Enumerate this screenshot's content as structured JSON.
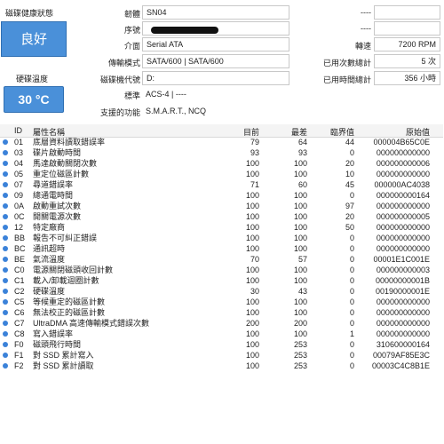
{
  "health": {
    "label": "磁碟健康狀態",
    "status": "良好"
  },
  "temperature": {
    "label": "硬碟溫度",
    "value": "30 °C"
  },
  "info": {
    "firmware_label": "韌體",
    "firmware_value": "SN04",
    "serial_label": "序號",
    "interface_label": "介面",
    "interface_value": "Serial ATA",
    "transfer_label": "傳輸模式",
    "transfer_value": "SATA/600 | SATA/600",
    "drive_letter_label": "磁碟機代號",
    "drive_letter_value": "D:",
    "standard_label": "標準",
    "standard_value": "ACS-4 | ----",
    "features_label": "支援的功能",
    "features_value": "S.M.A.R.T., NCQ",
    "right_blank1_label": "----",
    "right_blank1_value": "",
    "right_blank2_label": "----",
    "right_blank2_value": "",
    "rpm_label": "轉速",
    "rpm_value": "7200 RPM",
    "power_count_label": "已用次數總計",
    "power_count_value": "5 次",
    "power_hours_label": "已用時間總計",
    "power_hours_value": "356 小時"
  },
  "table": {
    "headers": {
      "id": "ID",
      "name": "屬性名稱",
      "current": "目前",
      "worst": "最差",
      "threshold": "臨界值",
      "raw": "原始值"
    },
    "rows": [
      {
        "id": "01",
        "name": "底層資料讀取錯誤率",
        "current": "79",
        "worst": "64",
        "threshold": "44",
        "raw": "000004B65C0E"
      },
      {
        "id": "03",
        "name": "碟片啟動時間",
        "current": "93",
        "worst": "93",
        "threshold": "0",
        "raw": "000000000000"
      },
      {
        "id": "04",
        "name": "馬達啟動關閉次數",
        "current": "100",
        "worst": "100",
        "threshold": "20",
        "raw": "000000000006"
      },
      {
        "id": "05",
        "name": "重定位磁區計數",
        "current": "100",
        "worst": "100",
        "threshold": "10",
        "raw": "000000000000"
      },
      {
        "id": "07",
        "name": "尋道錯誤率",
        "current": "71",
        "worst": "60",
        "threshold": "45",
        "raw": "000000AC4038"
      },
      {
        "id": "09",
        "name": "總通電時間",
        "current": "100",
        "worst": "100",
        "threshold": "0",
        "raw": "000000000164"
      },
      {
        "id": "0A",
        "name": "啟動重試次數",
        "current": "100",
        "worst": "100",
        "threshold": "97",
        "raw": "000000000000"
      },
      {
        "id": "0C",
        "name": "開關電源次數",
        "current": "100",
        "worst": "100",
        "threshold": "20",
        "raw": "000000000005"
      },
      {
        "id": "12",
        "name": "特定廠商",
        "current": "100",
        "worst": "100",
        "threshold": "50",
        "raw": "000000000000"
      },
      {
        "id": "BB",
        "name": "報告不可糾正錯誤",
        "current": "100",
        "worst": "100",
        "threshold": "0",
        "raw": "000000000000"
      },
      {
        "id": "BC",
        "name": "通訊超時",
        "current": "100",
        "worst": "100",
        "threshold": "0",
        "raw": "000000000000"
      },
      {
        "id": "BE",
        "name": "氣流溫度",
        "current": "70",
        "worst": "57",
        "threshold": "0",
        "raw": "00001E1C001E"
      },
      {
        "id": "C0",
        "name": "電源關閉磁頭收回計數",
        "current": "100",
        "worst": "100",
        "threshold": "0",
        "raw": "000000000003"
      },
      {
        "id": "C1",
        "name": "載入/卸載迴圈計數",
        "current": "100",
        "worst": "100",
        "threshold": "0",
        "raw": "00000000001B"
      },
      {
        "id": "C2",
        "name": "硬碟溫度",
        "current": "30",
        "worst": "43",
        "threshold": "0",
        "raw": "00190000001E"
      },
      {
        "id": "C5",
        "name": "等候重定的磁區計數",
        "current": "100",
        "worst": "100",
        "threshold": "0",
        "raw": "000000000000"
      },
      {
        "id": "C6",
        "name": "無法校正的磁區計數",
        "current": "100",
        "worst": "100",
        "threshold": "0",
        "raw": "000000000000"
      },
      {
        "id": "C7",
        "name": "UltraDMA 高速傳輸模式錯誤次數",
        "current": "200",
        "worst": "200",
        "threshold": "0",
        "raw": "000000000000"
      },
      {
        "id": "C8",
        "name": "寫入錯誤率",
        "current": "100",
        "worst": "100",
        "threshold": "1",
        "raw": "000000000000"
      },
      {
        "id": "F0",
        "name": "磁頭飛行時間",
        "current": "100",
        "worst": "253",
        "threshold": "0",
        "raw": "310600000164"
      },
      {
        "id": "F1",
        "name": "對 SSD 累計寫入",
        "current": "100",
        "worst": "253",
        "threshold": "0",
        "raw": "00079AF85E3C"
      },
      {
        "id": "F2",
        "name": "對 SSD 累計讀取",
        "current": "100",
        "worst": "253",
        "threshold": "0",
        "raw": "00003C4C8B1E"
      }
    ]
  },
  "colors": {
    "accent": "#4a90d9",
    "status_dot": "#3b82d9"
  }
}
